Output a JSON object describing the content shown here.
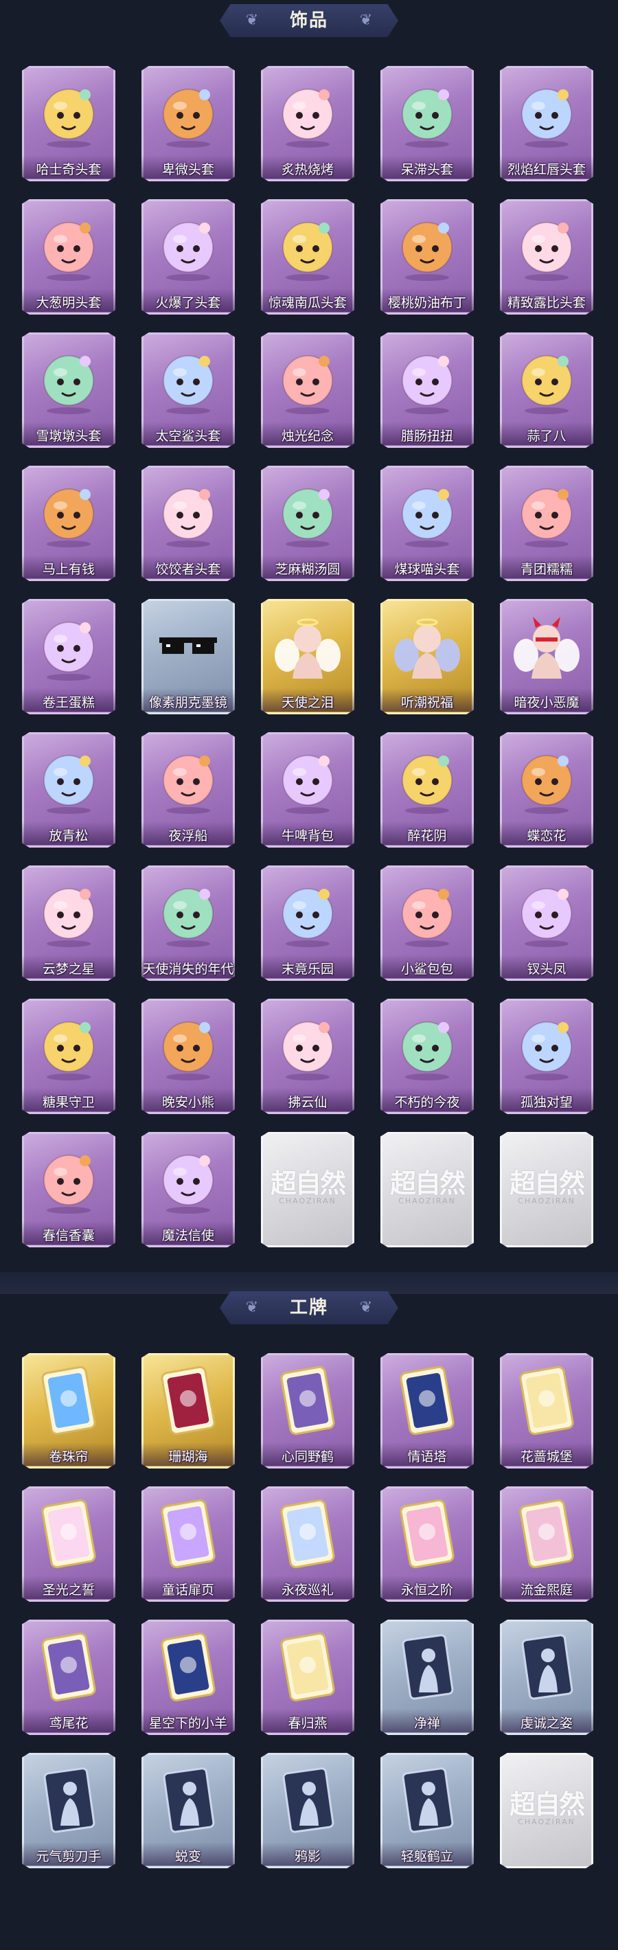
{
  "sections": [
    {
      "title": "饰品",
      "items": [
        {
          "label": "哈士奇头套",
          "rarity": "purple",
          "icon": "husky-head-icon"
        },
        {
          "label": "卑微头套",
          "rarity": "purple",
          "icon": "sad-face-head-icon"
        },
        {
          "label": "炙热烧烤",
          "rarity": "purple",
          "icon": "bbq-head-icon"
        },
        {
          "label": "呆滞头套",
          "rarity": "purple",
          "icon": "dazed-face-head-icon"
        },
        {
          "label": "烈焰红唇头套",
          "rarity": "purple",
          "icon": "red-lips-head-icon"
        },
        {
          "label": "大葱明头套",
          "rarity": "purple",
          "icon": "scallion-head-icon"
        },
        {
          "label": "火爆了头套",
          "rarity": "purple",
          "icon": "flame-head-icon"
        },
        {
          "label": "惊魂南瓜头套",
          "rarity": "purple",
          "icon": "pumpkin-head-icon"
        },
        {
          "label": "樱桃奶油布丁",
          "rarity": "purple",
          "icon": "pudding-head-icon"
        },
        {
          "label": "精致露比头套",
          "rarity": "purple",
          "icon": "pink-pig-head-icon"
        },
        {
          "label": "雪墩墩头套",
          "rarity": "purple",
          "icon": "snowman-head-icon"
        },
        {
          "label": "太空鲨头套",
          "rarity": "purple",
          "icon": "space-shark-head-icon"
        },
        {
          "label": "烛光纪念",
          "rarity": "purple",
          "icon": "candle-head-icon"
        },
        {
          "label": "腊肠扭扭",
          "rarity": "purple",
          "icon": "sausage-dog-head-icon"
        },
        {
          "label": "蒜了八",
          "rarity": "purple",
          "icon": "garlic-head-icon"
        },
        {
          "label": "马上有钱",
          "rarity": "purple",
          "icon": "horse-head-icon"
        },
        {
          "label": "饺饺者头套",
          "rarity": "purple",
          "icon": "dumpling-head-icon"
        },
        {
          "label": "芝麻糊汤圆",
          "rarity": "purple",
          "icon": "tangyuan-head-icon"
        },
        {
          "label": "煤球喵头套",
          "rarity": "purple",
          "icon": "black-cat-head-icon"
        },
        {
          "label": "青团糯糯",
          "rarity": "purple",
          "icon": "green-rice-ball-head-icon"
        },
        {
          "label": "卷王蛋糕",
          "rarity": "purple",
          "icon": "roll-cake-head-icon"
        },
        {
          "label": "像素朋克墨镜",
          "rarity": "blue",
          "icon": "pixel-sunglasses-icon"
        },
        {
          "label": "天使之泪",
          "rarity": "gold",
          "icon": "angel-wings-icon"
        },
        {
          "label": "听潮祝福",
          "rarity": "gold",
          "icon": "tide-wings-icon"
        },
        {
          "label": "暗夜小恶魔",
          "rarity": "purple",
          "icon": "devil-horns-icon"
        },
        {
          "label": "放青松",
          "rarity": "purple",
          "icon": "bonsai-backpack-icon"
        },
        {
          "label": "夜浮船",
          "rarity": "purple",
          "icon": "jellyfish-ornament-icon"
        },
        {
          "label": "牛啤背包",
          "rarity": "purple",
          "icon": "beer-backpack-icon"
        },
        {
          "label": "醉花阴",
          "rarity": "purple",
          "icon": "dreamcatcher-icon"
        },
        {
          "label": "蝶恋花",
          "rarity": "purple",
          "icon": "bell-ornament-icon"
        },
        {
          "label": "云梦之星",
          "rarity": "purple",
          "icon": "unicorn-cloud-icon"
        },
        {
          "label": "天使消失的年代",
          "rarity": "purple",
          "icon": "angel-doll-icon"
        },
        {
          "label": "末竟乐园",
          "rarity": "purple",
          "icon": "clown-doll-icon"
        },
        {
          "label": "小鲨包包",
          "rarity": "purple",
          "icon": "shark-bag-icon"
        },
        {
          "label": "钗头凤",
          "rarity": "purple",
          "icon": "phoenix-crown-icon"
        },
        {
          "label": "糖果守卫",
          "rarity": "purple",
          "icon": "scarecrow-pendant-icon"
        },
        {
          "label": "晚安小熊",
          "rarity": "purple",
          "icon": "bear-pendant-icon"
        },
        {
          "label": "拂云仙",
          "rarity": "purple",
          "icon": "fairy-pendant-icon"
        },
        {
          "label": "不朽的今夜",
          "rarity": "purple",
          "icon": "pink-cat-pendant-icon"
        },
        {
          "label": "孤独对望",
          "rarity": "purple",
          "icon": "moon-pendant-icon"
        },
        {
          "label": "春信香囊",
          "rarity": "purple",
          "icon": "sachet-icon"
        },
        {
          "label": "魔法信使",
          "rarity": "purple",
          "icon": "elephant-doll-icon"
        },
        {
          "label": "",
          "rarity": "gray",
          "icon": "logo-placeholder-icon"
        },
        {
          "label": "",
          "rarity": "gray",
          "icon": "logo-placeholder-icon"
        },
        {
          "label": "",
          "rarity": "gray",
          "icon": "logo-placeholder-icon"
        }
      ]
    },
    {
      "title": "工牌",
      "items": [
        {
          "label": "卷珠帘",
          "rarity": "gold",
          "icon": "badge-curtain-icon"
        },
        {
          "label": "珊瑚海",
          "rarity": "gold",
          "icon": "badge-coral-icon"
        },
        {
          "label": "心同野鹤",
          "rarity": "purple",
          "icon": "badge-crane-icon"
        },
        {
          "label": "情语塔",
          "rarity": "purple",
          "icon": "badge-tower-icon"
        },
        {
          "label": "花蔷城堡",
          "rarity": "purple",
          "icon": "badge-castle-icon"
        },
        {
          "label": "圣光之誓",
          "rarity": "purple",
          "icon": "badge-holy-light-icon"
        },
        {
          "label": "童话扉页",
          "rarity": "purple",
          "icon": "badge-fairytale-icon"
        },
        {
          "label": "永夜巡礼",
          "rarity": "purple",
          "icon": "badge-night-icon"
        },
        {
          "label": "永恒之阶",
          "rarity": "purple",
          "icon": "badge-stairs-icon"
        },
        {
          "label": "流金熙庭",
          "rarity": "purple",
          "icon": "badge-golden-court-icon"
        },
        {
          "label": "鸢尾花",
          "rarity": "purple",
          "icon": "badge-iris-icon"
        },
        {
          "label": "星空下的小羊",
          "rarity": "purple",
          "icon": "badge-lamb-icon"
        },
        {
          "label": "春归燕",
          "rarity": "purple",
          "icon": "badge-swallow-icon"
        },
        {
          "label": "净禅",
          "rarity": "blue",
          "icon": "badge-silhouette-icon"
        },
        {
          "label": "虔诚之姿",
          "rarity": "blue",
          "icon": "badge-silhouette-icon"
        },
        {
          "label": "元气剪刀手",
          "rarity": "blue",
          "icon": "badge-silhouette-icon"
        },
        {
          "label": "蜕变",
          "rarity": "blue",
          "icon": "badge-silhouette-icon"
        },
        {
          "label": "鸦影",
          "rarity": "blue",
          "icon": "badge-silhouette-icon"
        },
        {
          "label": "轻躯鹤立",
          "rarity": "blue",
          "icon": "badge-silhouette-icon"
        },
        {
          "label": "",
          "rarity": "gray",
          "icon": "logo-placeholder-icon"
        }
      ]
    }
  ],
  "watermark": {
    "text": "超自然",
    "sub": "CHAOZIRAN"
  },
  "colors": {
    "background": "#171c2b",
    "purple": "#a77cc3",
    "gold": "#e0b94c",
    "blue": "#9eafc6",
    "gray": "#dadade"
  }
}
